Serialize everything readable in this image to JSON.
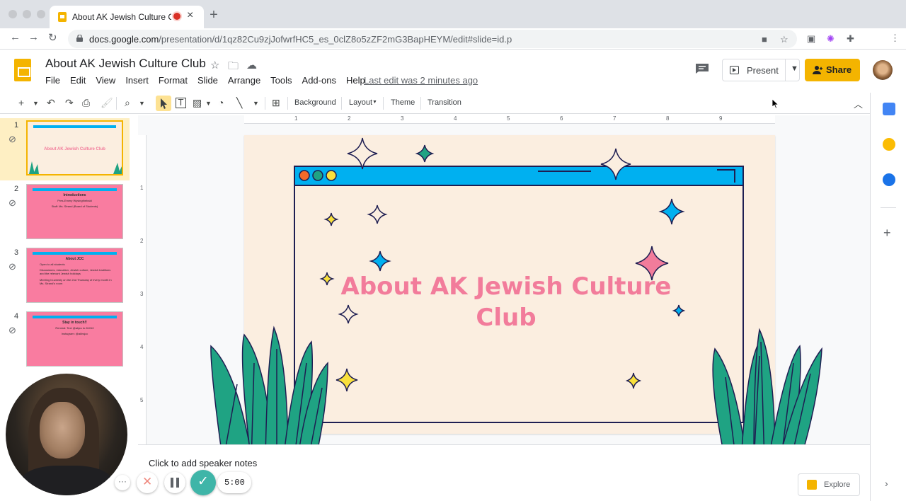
{
  "browser": {
    "tab_title": "About AK Jewish Culture C",
    "url_host": "docs.google.com",
    "url_path": "/presentation/d/1qz82Cu9zjJofwrfHC5_es_0clZ8o5zZF2mG3BapHEYM/edit#slide=id.p"
  },
  "doc": {
    "title": "About AK Jewish Culture Club",
    "last_edit": "Last edit was 2 minutes ago",
    "present_label": "Present",
    "share_label": "Share"
  },
  "menu": [
    "File",
    "Edit",
    "View",
    "Insert",
    "Format",
    "Slide",
    "Arrange",
    "Tools",
    "Add-ons",
    "Help"
  ],
  "toolbar": {
    "background": "Background",
    "layout": "Layout",
    "theme": "Theme",
    "transition": "Transition"
  },
  "ruler": {
    "h": [
      "1",
      "2",
      "3",
      "4",
      "5",
      "6",
      "7",
      "8",
      "9"
    ],
    "v": [
      "1",
      "2",
      "3",
      "4",
      "5"
    ]
  },
  "slides": [
    {
      "num": "1",
      "title": "About AK Jewish Culture Club",
      "lines": []
    },
    {
      "num": "2",
      "title": "Introductions",
      "lines": [
        "Pres-Emery Wysingthebald",
        "Staff: Ms. Strand (Board of Students)"
      ]
    },
    {
      "num": "3",
      "title": "About JCC",
      "lines": [
        "Open to all students",
        "Discussions, education, Jewish culture, Jewish traditions and the relevant Jewish holidays",
        "Meeting bi-weekly on the 2nd Thursday of every month in Ms. Strand's room"
      ]
    },
    {
      "num": "4",
      "title": "Stay in touch!!",
      "lines": [
        "Remind: Text @akjcc to 81010",
        "Instagram: @akhsjcc"
      ]
    }
  ],
  "slide": {
    "title_line1": "About AK Jewish Culture",
    "title_line2": "Club"
  },
  "notes": {
    "placeholder": "Click to add speaker notes"
  },
  "explore_label": "Explore",
  "recorder": {
    "timer": "5:00",
    "more": "···"
  },
  "colors": {
    "accent": "#f4b400",
    "slide_bg": "#fbeee0",
    "title_pink": "#f27c9b",
    "window_bar": "#00b0f0",
    "thumb_pink": "#f97ca0",
    "leaf_green": "#1fa383",
    "done_teal": "#3fb5a8"
  }
}
